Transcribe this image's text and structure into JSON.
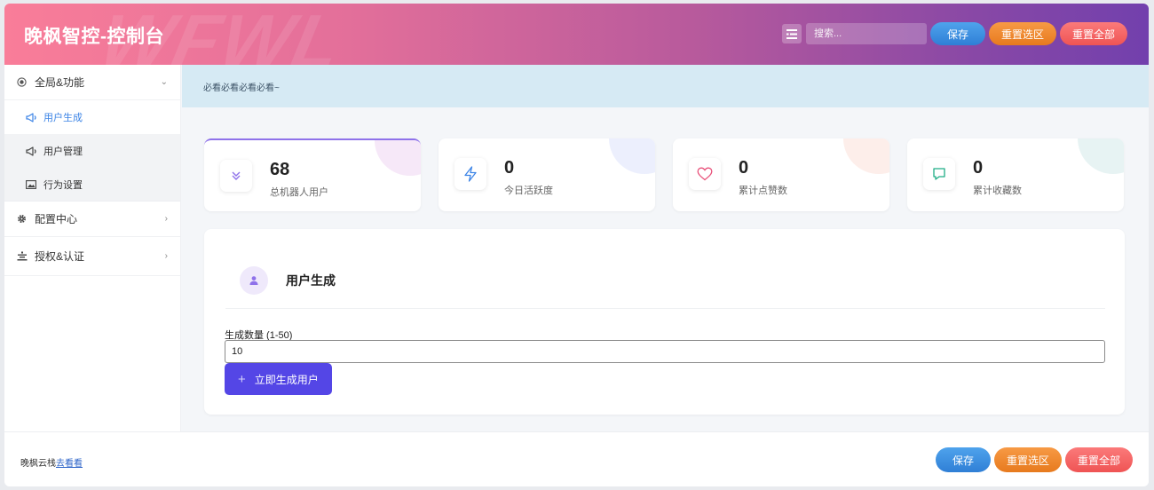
{
  "header": {
    "title": "晚枫智控-控制台",
    "watermark": "WFWL",
    "search_placeholder": "搜索...",
    "save_label": "保存",
    "reset_selection_label": "重置选区",
    "reset_all_label": "重置全部"
  },
  "sidebar": {
    "groups": [
      {
        "label": "全局&功能",
        "icon": "radio-dot-icon",
        "expanded": true,
        "items": [
          {
            "label": "用户生成",
            "icon": "megaphone-icon",
            "active": true
          },
          {
            "label": "用户管理",
            "icon": "megaphone-icon",
            "active": false
          },
          {
            "label": "行为设置",
            "icon": "image-icon",
            "active": false
          }
        ]
      },
      {
        "label": "配置中心",
        "icon": "gear-icon",
        "expanded": false
      },
      {
        "label": "授权&认证",
        "icon": "podium-icon",
        "expanded": false
      }
    ]
  },
  "notice": {
    "text": "必看必看必看必看~"
  },
  "stats": [
    {
      "value": "68",
      "label": "总机器人用户",
      "icon": "double-chevron-down-icon",
      "color": "#8f72ea"
    },
    {
      "value": "0",
      "label": "今日活跃度",
      "icon": "lightning-icon",
      "color": "#3c84e6"
    },
    {
      "value": "0",
      "label": "累计点赞数",
      "icon": "heart-icon",
      "color": "#e8517a"
    },
    {
      "value": "0",
      "label": "累计收藏数",
      "icon": "bookmark-icon",
      "color": "#1fae86"
    }
  ],
  "panel": {
    "title": "用户生成",
    "icon": "user-icon",
    "field_label": "生成数量 (1-50)",
    "field_value": "10",
    "generate_label": "立即生成用户"
  },
  "footer": {
    "text": "晚枫云栈",
    "link_text": "去看看",
    "save_label": "保存",
    "reset_selection_label": "重置选区",
    "reset_all_label": "重置全部"
  },
  "colors": {
    "accent_purple": "#5446e6",
    "active_nav": "#3c84e6",
    "notice_bg": "#d6eaf4"
  }
}
